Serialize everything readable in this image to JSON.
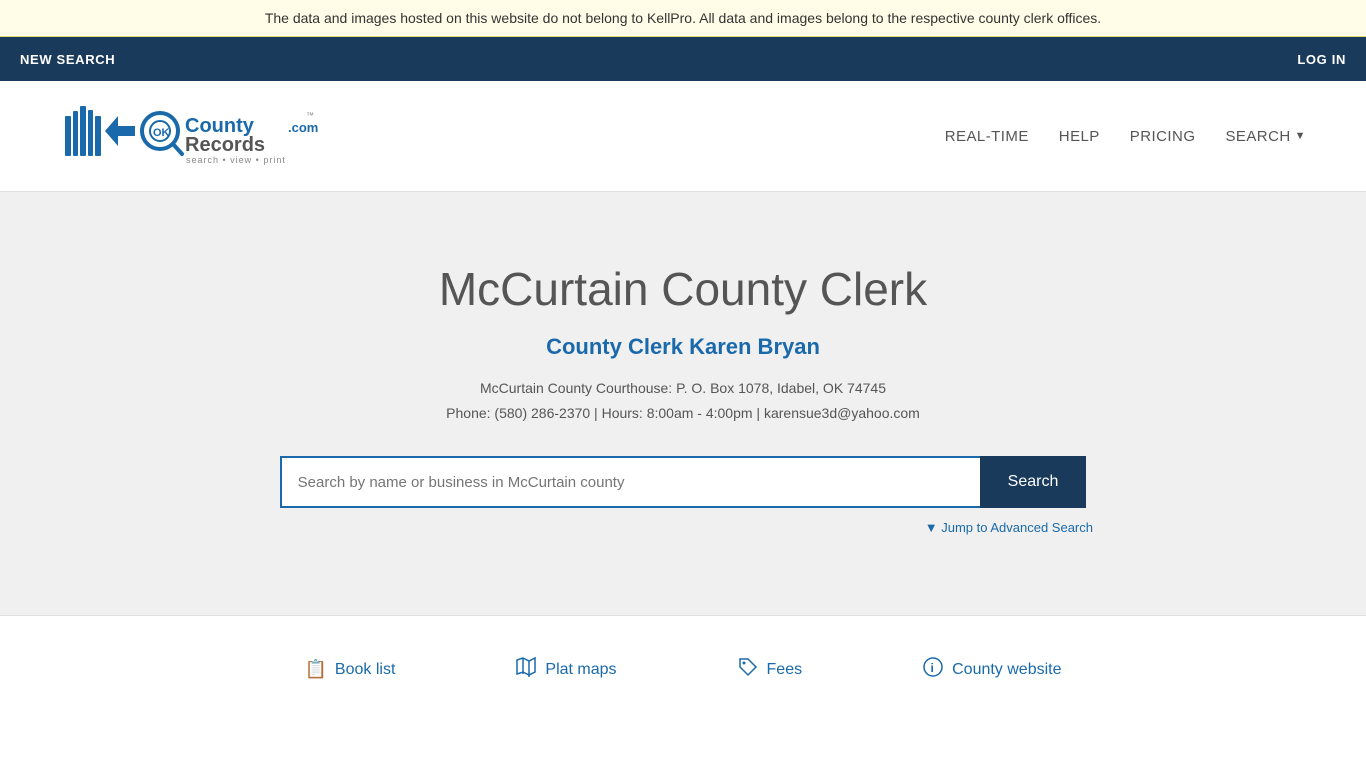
{
  "banner": {
    "text": "The data and images hosted on this website do not belong to KellPro. All data and images belong to the respective county clerk offices."
  },
  "top_nav": {
    "new_search_label": "NEW SEARCH",
    "log_in_label": "LOG IN"
  },
  "header": {
    "logo_alt": "OKCountyRecords.com",
    "logo_tagline": "search • view • print",
    "nav": {
      "real_time": "REAL-TIME",
      "help": "HELP",
      "pricing": "PRICING",
      "search": "SEARCH"
    }
  },
  "hero": {
    "title": "McCurtain County Clerk",
    "clerk_name": "County Clerk Karen Bryan",
    "address_line1": "McCurtain County Courthouse: P. O. Box 1078, Idabel, OK 74745",
    "address_line2": "Phone: (580) 286-2370 | Hours: 8:00am - 4:00pm | karensue3d@yahoo.com",
    "search_placeholder": "Search by name or business in McCurtain county",
    "search_button_label": "Search",
    "advanced_search_label": "▼ Jump to Advanced Search"
  },
  "footer": {
    "links": [
      {
        "icon": "📋",
        "label": "Book list"
      },
      {
        "icon": "🗺",
        "label": "Plat maps"
      },
      {
        "icon": "🏷",
        "label": "Fees"
      },
      {
        "icon": "ℹ",
        "label": "County website"
      }
    ]
  }
}
